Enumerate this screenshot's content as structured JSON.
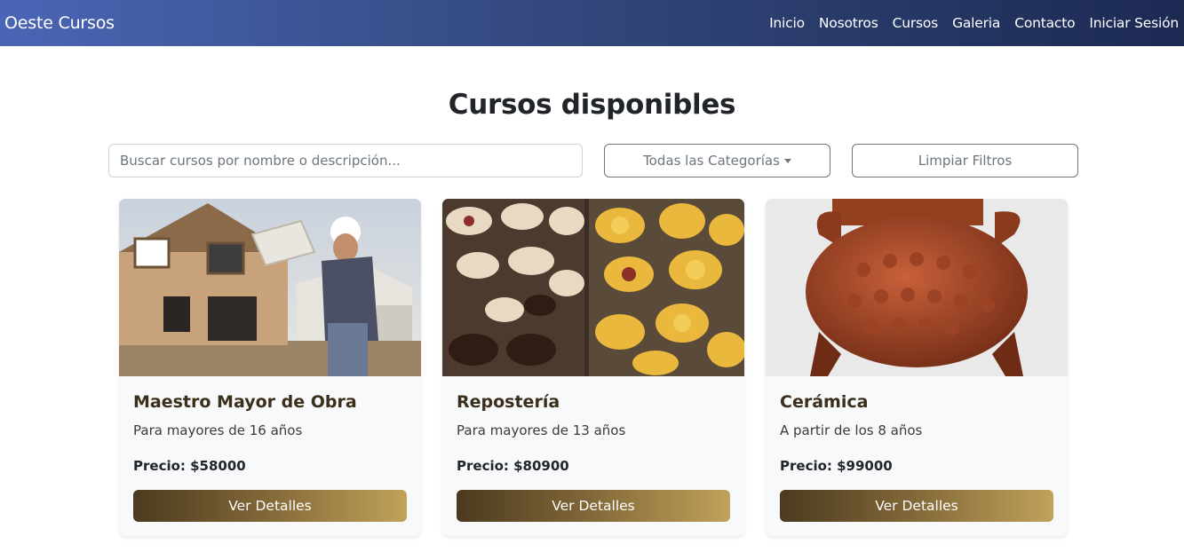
{
  "navbar": {
    "brand": "Oeste Cursos",
    "links": [
      "Inicio",
      "Nosotros",
      "Cursos",
      "Galeria",
      "Contacto",
      "Iniciar Sesión"
    ]
  },
  "page": {
    "title": "Cursos disponibles"
  },
  "filters": {
    "search_placeholder": "Buscar cursos por nombre o descripción...",
    "search_value": "",
    "category_label": "Todas las Categorías",
    "clear_label": "Limpiar Filtros"
  },
  "courses": [
    {
      "title": "Maestro Mayor de Obra",
      "description": "Para mayores de 16 años",
      "price": "Precio: $58000",
      "button": "Ver Detalles",
      "image": "construction-worker-photo"
    },
    {
      "title": "Repostería",
      "description": "Para mayores de 13 años",
      "price": "Precio: $80900",
      "button": "Ver Detalles",
      "image": "pastries-photo"
    },
    {
      "title": "Cerámica",
      "description": "A partir de los 8 años",
      "price": "Precio: $99000",
      "button": "Ver Detalles",
      "image": "clay-pot-photo"
    }
  ],
  "colors": {
    "navbar_start": "#4a65b5",
    "navbar_end": "#1c2a52",
    "button_start": "#4b3a1f",
    "button_end": "#c0a25a",
    "card_bg": "#f8f9fa"
  }
}
